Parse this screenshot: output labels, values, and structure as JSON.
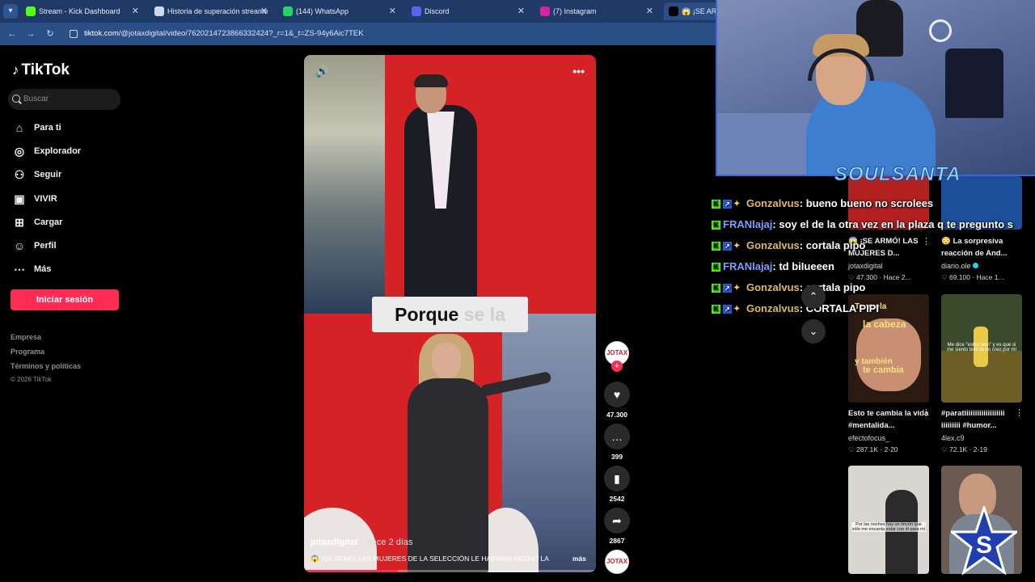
{
  "browser": {
    "tabs": [
      {
        "label": "Stream - Kick Dashboard",
        "favicon_color": "#53fc18",
        "favicon_text": "K"
      },
      {
        "label": "Historia de superación streame",
        "favicon_color": "#cfd8e8",
        "favicon_text": "◎"
      },
      {
        "label": "(144) WhatsApp",
        "favicon_color": "#25d366",
        "favicon_text": "✆"
      },
      {
        "label": "Discord",
        "favicon_color": "#5865f2",
        "favicon_text": "◉"
      },
      {
        "label": "(7) Instagram",
        "favicon_color": "#d6249f",
        "favicon_text": "◎"
      },
      {
        "label": "😱 ¡SE ARMÓ!",
        "favicon_color": "#000000",
        "favicon_text": "♪"
      }
    ],
    "url_host": "tiktok.com",
    "url_path": "/@jotaxdigital/video/7620214723866332424?_r=1&_t=ZS-94y6Aic7TEK"
  },
  "sidebar": {
    "logo": "TikTok",
    "search_placeholder": "Buscar",
    "items": [
      {
        "label": "Para ti",
        "icon": "home-icon"
      },
      {
        "label": "Explorador",
        "icon": "compass-icon"
      },
      {
        "label": "Seguir",
        "icon": "user-follow-icon"
      },
      {
        "label": "VIVIR",
        "icon": "live-icon"
      },
      {
        "label": "Cargar",
        "icon": "upload-icon"
      },
      {
        "label": "Perfil",
        "icon": "profile-icon"
      },
      {
        "label": "Más",
        "icon": "more-icon"
      }
    ],
    "login_label": "Iniciar sesión",
    "footer_links": [
      "Empresa",
      "Programa",
      "Términos y políticas"
    ],
    "copyright": "© 2026 TikTok"
  },
  "video": {
    "caption_main": "Porque",
    "caption_faded": "se la",
    "author": "jotaxdigital",
    "time": "· Hace 2 días",
    "description": "😱 ¡SE ARMÓ! LAS MUJERES DE LA SELECCIÓN LE HABRÍAN HECHO LA",
    "more_label": "más",
    "progress": 0.32,
    "accent": "#fe2c55"
  },
  "actions": {
    "avatar_text": "JOTAX",
    "likes": "47.300",
    "comments": "399",
    "saves": "2542",
    "shares": "2867"
  },
  "stream_overlay": {
    "streamer_name": "SOULSANTA"
  },
  "chat": [
    {
      "user": "Gonzalvus",
      "message": ": bueno bueno no scrolees",
      "color": "gold",
      "badges": 3
    },
    {
      "user": "FRANlajaj",
      "message": ": soy el de la otra vez en la plaza q te pregunto s",
      "color": "blue",
      "badges": 1
    },
    {
      "user": "Gonzalvus",
      "message": ": cortala pipo",
      "color": "gold",
      "badges": 3
    },
    {
      "user": "FRANlajaj",
      "message": ": td biIueeen",
      "color": "blue",
      "badges": 1
    },
    {
      "user": "Gonzalvus",
      "message": ": cortala pipo",
      "color": "gold",
      "badges": 3
    },
    {
      "user": "Gonzalvus",
      "message": ": CORTALA PIPI",
      "color": "gold",
      "badges": 3
    }
  ],
  "suggestions": [
    {
      "title": "😱 ¡SE ARMÓ! LAS MUJERES D...",
      "author": "jotaxdigital",
      "likes": "47.300",
      "time": "Hace 2...",
      "verified": false,
      "thumb_color": "#b22020"
    },
    {
      "title": "😳 La sorpresiva reacción de And...",
      "author": "diario.ole",
      "likes": "69.100",
      "time": "Hace 1...",
      "verified": true,
      "thumb_color": "#1b4f9a"
    },
    {
      "title": "Esto te cambia la vida #mentalida...",
      "author": "efectofocus_",
      "likes": "287.1K",
      "time": "2-20",
      "verified": false,
      "thumb_color": "#2a1a12",
      "thumb_text_1": "Te vuela",
      "thumb_text_2": "la cabeza",
      "thumb_text_3": "y también",
      "thumb_text_4": "te cambia"
    },
    {
      "title": "#paratiiiiiiiiiiiiiiiiiii iiiiiiiii #humor...",
      "author": "4lex.c9",
      "likes": "72.1K",
      "time": "2-19",
      "verified": false,
      "thumb_color": "#3b4a2a",
      "thumb_text_1": "Me dice \"estas bien\" y es que si me siento bien tu no creo por mi"
    },
    {
      "title": "",
      "author": "",
      "likes": "",
      "time": "",
      "verified": false,
      "thumb_color": "#d9d6d2",
      "thumb_text_1": "Por las noches hay un rincón que sólo me encanta estar con él para mí"
    },
    {
      "title": "",
      "author": "",
      "likes": "",
      "time": "",
      "verified": false,
      "thumb_color": "#6b5a52"
    }
  ]
}
